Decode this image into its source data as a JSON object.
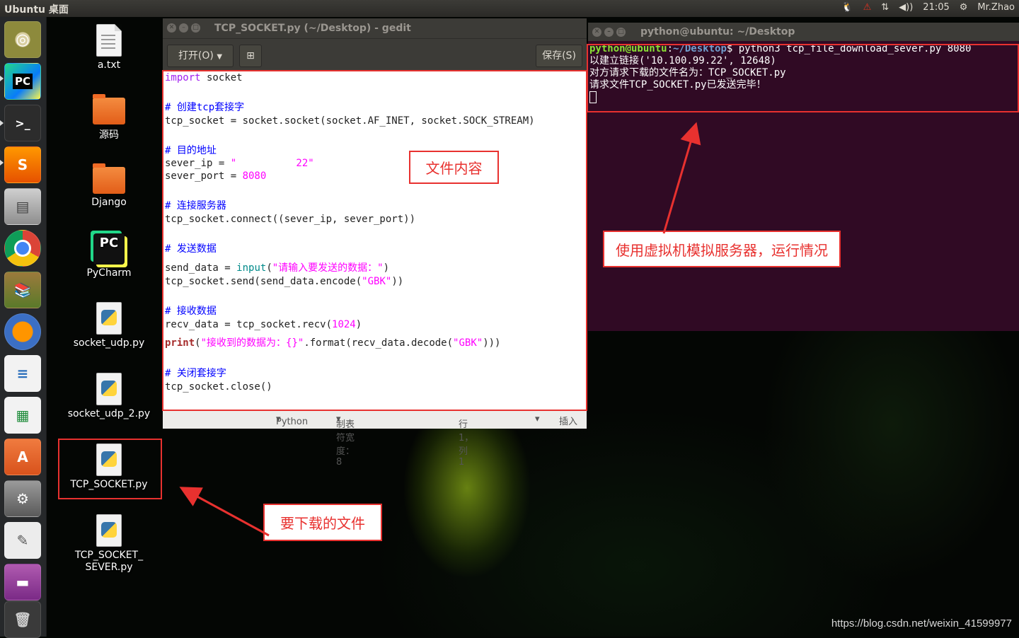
{
  "top_panel": {
    "title": "Ubuntu 桌面",
    "time": "21:05",
    "user": "Mr.Zhao",
    "volume_glyph": "◀))",
    "network_glyph": "⇅",
    "settings_glyph": "⚙"
  },
  "launcher": {
    "items": [
      "ubuntu-dash",
      "pycharm",
      "terminal",
      "sublime-text",
      "files",
      "chrome",
      "book",
      "firefox",
      "writer",
      "calc",
      "software-center",
      "system-settings",
      "text-editor",
      "monitor",
      "trash"
    ]
  },
  "desktop_icons": [
    {
      "label": "a.txt"
    },
    {
      "label": "源码"
    },
    {
      "label": "Django"
    },
    {
      "label": "PyCharm"
    },
    {
      "label": "socket_udp.py"
    },
    {
      "label": "socket_udp_2.py"
    },
    {
      "label": "TCP_SOCKET.py"
    },
    {
      "label": "TCP_SOCKET_",
      "label2": "SEVER.py"
    }
  ],
  "gedit": {
    "title": "TCP_SOCKET.py (~/Desktop) - gedit",
    "open_label": "打开(O)",
    "save_label": "保存(S)",
    "code": {
      "l1_kw": "import",
      "l1_rest": " socket",
      "c1": "# 创建tcp套接字",
      "l2": "tcp_socket = socket.socket(socket.AF_INET, socket.SOCK_STREAM)",
      "c2": "# 目的地址",
      "l3a": "sever_ip = ",
      "l3s": "\"          22\"",
      "l4a": "sever_port = ",
      "l4n": "8080",
      "c3": "# 连接服务器",
      "l5": "tcp_socket.connect((sever_ip, sever_port))",
      "c4": "# 发送数据",
      "l6a": "send_data = ",
      "l6f": "input",
      "l6b": "(",
      "l6s": "\"请输入要发送的数据：\"",
      "l6c": ")",
      "l7a": "tcp_socket.send(send_data.encode(",
      "l7s": "\"GBK\"",
      "l7b": "))",
      "c5": "# 接收数据",
      "l8a": "recv_data = tcp_socket.recv(",
      "l8n": "1024",
      "l8b": ")",
      "l9f": "print",
      "l9a": "(",
      "l9s": "\"接收到的数据为：{}\"",
      "l9b": ".format(recv_data.decode(",
      "l9s2": "\"GBK\"",
      "l9c": ")))",
      "c6": "# 关闭套接字",
      "l10": "tcp_socket.close()"
    },
    "status": {
      "language": "Python",
      "tab_width": "制表符宽度：8",
      "position": "行 1，列 1",
      "mode": "插入"
    }
  },
  "terminal": {
    "title": "python@ubuntu: ~/Desktop",
    "prompt_user": "python@ubuntu",
    "prompt_sep": ":",
    "prompt_path": "~/Desktop",
    "command": "$ python3 tcp_file_download_sever.py 8080",
    "out1": "以建立链接('10.100.99.22', 12648)",
    "out2": "对方请求下载的文件名为：TCP_SOCKET.py",
    "out3": "请求文件TCP_SOCKET.py已发送完毕！"
  },
  "annotations": {
    "file_content": "文件内容",
    "server_note": "使用虚拟机模拟服务器，运行情况",
    "download_note": "要下载的文件"
  },
  "watermark": "https://blog.csdn.net/weixin_41599977",
  "colors": {
    "annotation_red": "#e8312f",
    "terminal_bg": "#300a24",
    "launcher_bg": "#26282a"
  }
}
